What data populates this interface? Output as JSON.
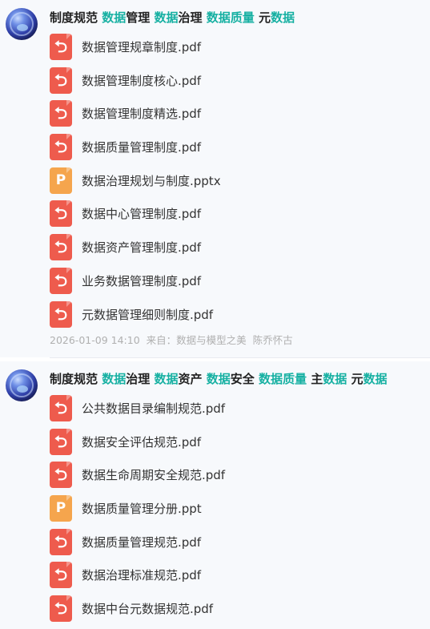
{
  "posts": [
    {
      "title_parts": [
        {
          "text": "制度规范 ",
          "hl": false
        },
        {
          "text": "数据",
          "hl": true
        },
        {
          "text": "管理 ",
          "hl": false
        },
        {
          "text": "数据",
          "hl": true
        },
        {
          "text": "治理 ",
          "hl": false
        },
        {
          "text": "数据质量",
          "hl": true
        },
        {
          "text": " 元",
          "hl": false
        },
        {
          "text": "数据",
          "hl": true
        }
      ],
      "files": [
        {
          "name": "数据管理规章制度.pdf",
          "type": "pdf"
        },
        {
          "name": "数据管理制度核心.pdf",
          "type": "pdf"
        },
        {
          "name": "数据管理制度精选.pdf",
          "type": "pdf"
        },
        {
          "name": "数据质量管理制度.pdf",
          "type": "pdf"
        },
        {
          "name": "数据治理规划与制度.pptx",
          "type": "ppt"
        },
        {
          "name": "数据中心管理制度.pdf",
          "type": "pdf"
        },
        {
          "name": "数据资产管理制度.pdf",
          "type": "pdf"
        },
        {
          "name": "业务数据管理制度.pdf",
          "type": "pdf"
        },
        {
          "name": "元数据管理细则制度.pdf",
          "type": "pdf"
        }
      ],
      "meta": {
        "datetime": "2026-01-09 14:10",
        "source": "来自：数据与模型之美",
        "author": "陈乔怀古"
      }
    },
    {
      "title_parts": [
        {
          "text": "制度规范 ",
          "hl": false
        },
        {
          "text": "数据",
          "hl": true
        },
        {
          "text": "治理 ",
          "hl": false
        },
        {
          "text": "数据",
          "hl": true
        },
        {
          "text": "资产 ",
          "hl": false
        },
        {
          "text": "数据",
          "hl": true
        },
        {
          "text": "安全 ",
          "hl": false
        },
        {
          "text": "数据质量",
          "hl": true
        },
        {
          "text": " 主",
          "hl": false
        },
        {
          "text": "数据",
          "hl": true
        },
        {
          "text": " 元",
          "hl": false
        },
        {
          "text": "数据",
          "hl": true
        }
      ],
      "files": [
        {
          "name": "公共数据目录编制规范.pdf",
          "type": "pdf"
        },
        {
          "name": "数据安全评估规范.pdf",
          "type": "pdf"
        },
        {
          "name": "数据生命周期安全规范.pdf",
          "type": "pdf"
        },
        {
          "name": "数据质量管理分册.ppt",
          "type": "ppt"
        },
        {
          "name": "数据质量管理规范.pdf",
          "type": "pdf"
        },
        {
          "name": "数据治理标准规范.pdf",
          "type": "pdf"
        },
        {
          "name": "数据中台元数据规范.pdf",
          "type": "pdf"
        }
      ]
    }
  ],
  "icons": {
    "pdf": {
      "glyph": "⮌",
      "color": "#ee5b4d"
    },
    "ppt": {
      "glyph": "P",
      "color": "#f5a54d"
    }
  },
  "colors": {
    "highlight": "#16b0a2",
    "meta_text": "#b0b0b0"
  }
}
